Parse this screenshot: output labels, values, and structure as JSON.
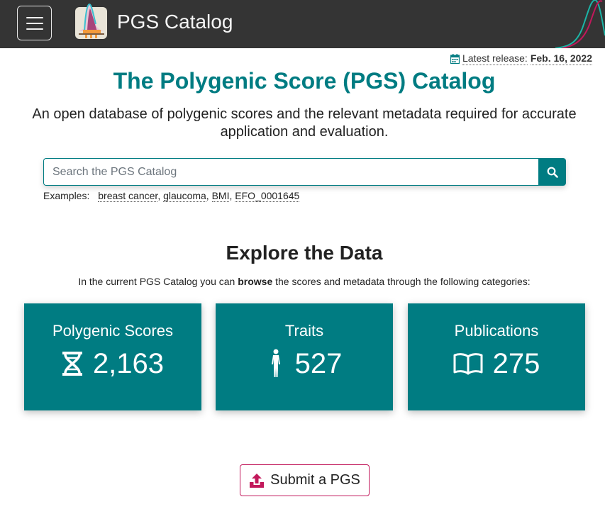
{
  "navbar": {
    "brand": "PGS Catalog",
    "menu_icon": "hamburger-menu-icon",
    "logo_icon": "pgs-logo-icon"
  },
  "release": {
    "label": "Latest release:",
    "date": "Feb. 16, 2022",
    "icon": "calendar-icon"
  },
  "hero": {
    "title": "The Polygenic Score (PGS) Catalog",
    "subtitle": "An open database of polygenic scores and the relevant metadata required for accurate application and evaluation."
  },
  "search": {
    "placeholder": "Search the PGS Catalog",
    "button_icon": "search-icon",
    "examples_label": "Examples:",
    "examples": [
      "breast cancer",
      "glaucoma",
      "BMI",
      "EFO_0001645"
    ]
  },
  "explore": {
    "heading": "Explore the Data",
    "intro_before": "In the current PGS Catalog you can ",
    "intro_bold": "browse",
    "intro_after": " the scores and metadata through the following categories:"
  },
  "cards": [
    {
      "title": "Polygenic Scores",
      "count": "2,163",
      "icon": "dna-icon"
    },
    {
      "title": "Traits",
      "count": "527",
      "icon": "human-figure-icon"
    },
    {
      "title": "Publications",
      "count": "275",
      "icon": "open-book-icon"
    }
  ],
  "submit": {
    "label": "Submit a PGS",
    "icon": "upload-icon"
  },
  "colors": {
    "navbar_bg": "#343434",
    "accent": "#007c82",
    "submit_accent": "#c2185b"
  }
}
